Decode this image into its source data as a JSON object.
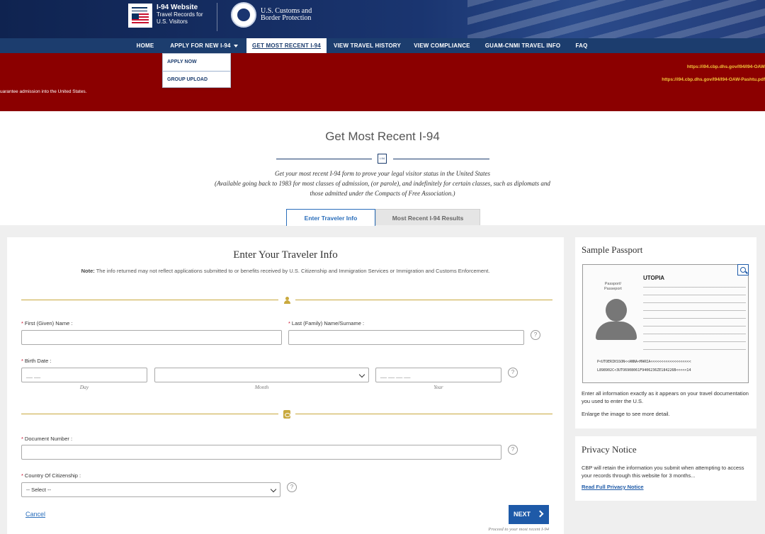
{
  "header": {
    "i94_title": "I-94 Website",
    "i94_sub1": "Travel Records for",
    "i94_sub2": "U.S. Visitors",
    "cbp_line1": "U.S. Customs and",
    "cbp_line2": "Border Protection"
  },
  "nav": {
    "items": [
      {
        "label": "HOME"
      },
      {
        "label": "APPLY FOR NEW I-94"
      },
      {
        "label": "GET MOST RECENT I-94"
      },
      {
        "label": "VIEW TRAVEL HISTORY"
      },
      {
        "label": "VIEW COMPLIANCE"
      },
      {
        "label": "GUAM-CNMI TRAVEL INFO"
      },
      {
        "label": "FAQ"
      }
    ],
    "active": "GET MOST RECENT I-94"
  },
  "dropdown": {
    "items": [
      {
        "label": "APPLY NOW"
      },
      {
        "label": "GROUP UPLOAD"
      }
    ]
  },
  "banner": {
    "link1": "https://i94.cbp.dhs.gov/I94/I94-OAW",
    "link2": "https://i94.cbp.dhs.gov/I94/I94-OAW-Pashtu.pdf",
    "message": "uarantee admission into the United States."
  },
  "page": {
    "title": "Get Most Recent I-94",
    "subtitle_line1": "Get your most recent I-94 form to prove your legal visitor status in the United States",
    "subtitle_line2": "(Available going back to 1983 for most classes of admission, (or parole), and indefinitely for certain classes, such as diplomats and",
    "subtitle_line3": "those admitted under the Compacts of Free Association.)",
    "icon_text": "I-94"
  },
  "tabs": [
    {
      "label": "Enter Traveler Info",
      "active": true
    },
    {
      "label": "Most Recent I-94 Results",
      "active": false
    }
  ],
  "form": {
    "title": "Enter Your Traveler Info",
    "note_bold": "Note:",
    "note_text": " The info returned may not reflect applications submitted to or benefits received by U.S. Citizenship and Immigration Services or Immigration and Customs Enforcement.",
    "required_mark": "*",
    "help_mark": "?",
    "first_name_label": "First (Given) Name :",
    "last_name_label": "Last (Family) Name/Surname :",
    "birth_date_label": "Birth Date :",
    "day_placeholder": "__ __",
    "year_placeholder": "__ __ __ __",
    "day_caption": "Day",
    "month_caption": "Month",
    "year_caption": "Year",
    "document_number_label": "Document Number :",
    "country_label": "Country Of Citizenship :",
    "country_selected": "-- Select --",
    "cancel_label": "Cancel",
    "next_label": "NEXT",
    "next_hint": "Proceed to your most recent I-94"
  },
  "sample_passport": {
    "title": "Sample Passport",
    "passport_label_1": "Passport/",
    "passport_label_2": "Passeport",
    "country": "UTOPIA",
    "mrz_line1": "P<UTOERIKSSON<<ANNA<MARIA<<<<<<<<<<<<<<<<<<<",
    "mrz_line2": "L898902C<3UTO6908061F9406236ZE184226B<<<<<14",
    "text1": "Enter all information exactly as it appears on your travel documentation you used to enter the U.S.",
    "text2": "Enlarge the image to see more detail."
  },
  "privacy": {
    "title": "Privacy Notice",
    "text": "CBP will retain the information you submit when attempting to access your records through this website for 3 months...",
    "link": "Read Full Privacy Notice"
  },
  "colors": {
    "navy": "#1c3d6e",
    "banner_red": "#8b0000",
    "gold": "#c9a93e",
    "link_blue": "#1e5aa8",
    "required_red": "#c8102e"
  }
}
